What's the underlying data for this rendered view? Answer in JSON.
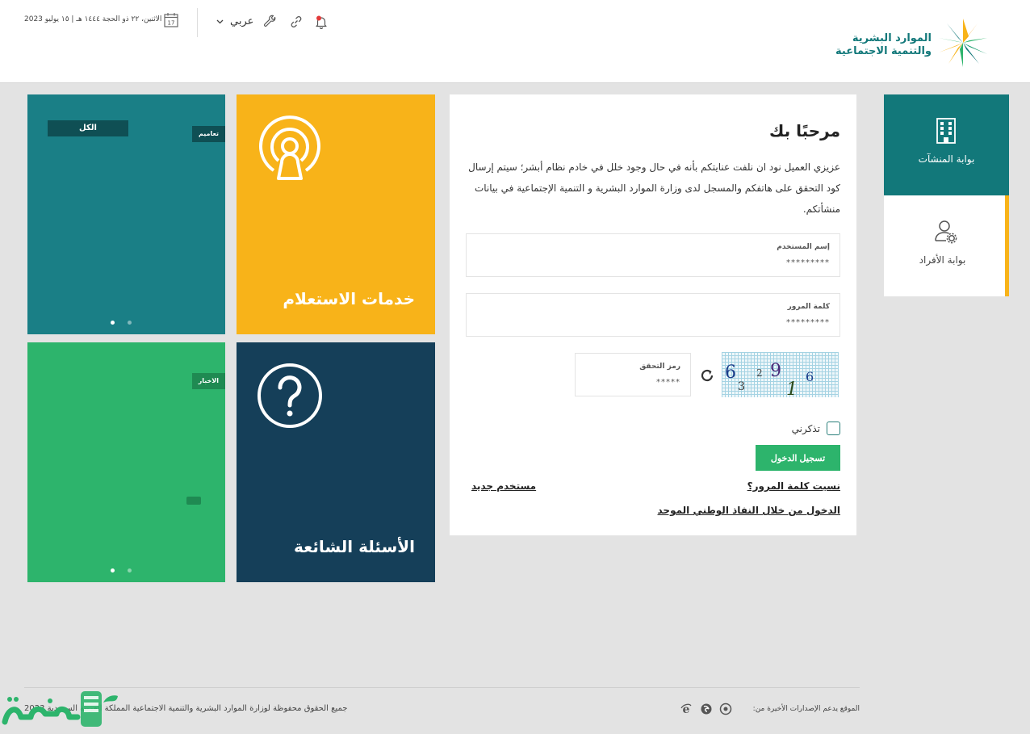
{
  "header": {
    "logo": {
      "line1": "الموارد البشرية",
      "line2": "والتنمية الاجتماعية"
    },
    "date": "الاثنين، ٢٢ ذو الحجة ١٤٤٤ هـ | ١٥ يوليو 2023",
    "calendar_day": "17",
    "language": "عربي",
    "icons": [
      "calendar-icon",
      "chevron-down-icon",
      "wrench-icon",
      "link-icon",
      "bell-icon"
    ]
  },
  "tiles": {
    "all": {
      "pill": "الكل",
      "tag": "تعاميم"
    },
    "inquiry": {
      "title": "خدمات الاستعلام"
    },
    "news": {
      "tag": "الاخبار"
    },
    "faq": {
      "title": "الأسئلة الشائعة"
    }
  },
  "login": {
    "welcome": "مرحبًا بك",
    "notice": "عزيزي العميل نود ان نلفت عنايتكم بأنه في حال وجود خلل في خادم نظام أبشر؛ سيتم إرسال كود التحقق على هاتفكم والمسجل لدى وزارة الموارد البشرية و التنمية الإجتماعية في بيانات منشأتكم.",
    "username": {
      "label": "إسم المستخدم",
      "value": "*********"
    },
    "password": {
      "label": "كلمة المرور",
      "value": "*********"
    },
    "captcha_field": {
      "label": "رمز التحقق",
      "value": "*****"
    },
    "captcha_digits": [
      "6",
      "3",
      "2",
      "9",
      "1",
      "6"
    ],
    "remember": "تذكرني",
    "submit": "تسجيل الدخول",
    "forgot": "نسيت كلمة المرور؟",
    "new_user": "مستخدم جديد",
    "nafath": "الدخول من خلال النفاذ الوطني الموحد"
  },
  "portals": {
    "establishments": "بوابة المنشآت",
    "individuals": "بوابة الأفراد"
  },
  "footer": {
    "copyright": "جميع الحقوق محفوظة لوزارة الموارد البشرية والتنمية الاجتماعية المملكة العربية السعودية 2023",
    "browsers_label": "الموقع يدعم الإصدارات الأخيرة من:"
  },
  "colors": {
    "teal": "#1a7f86",
    "yellow": "#f8b319",
    "green": "#2db46c",
    "navy": "#153f59",
    "brand": "#12787a"
  }
}
